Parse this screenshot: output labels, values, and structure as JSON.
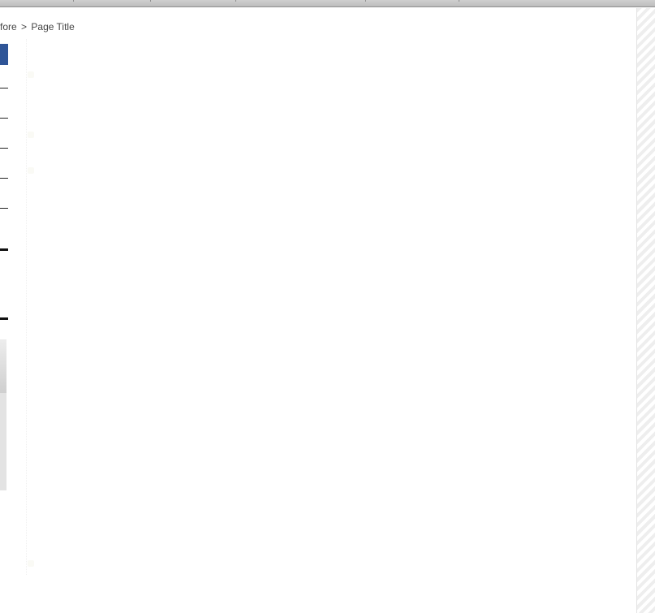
{
  "breadcrumb": {
    "parent": "fore",
    "separator": ">",
    "current": "Page Title"
  },
  "colors": {
    "nav_active": "#2f5597",
    "top_bar": "#c6c6c6",
    "panel_gray": "#e3e3e3",
    "scroll_stripe": "#eeeeee"
  }
}
